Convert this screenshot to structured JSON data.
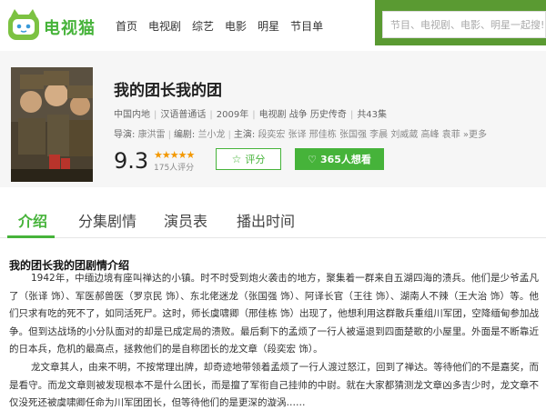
{
  "header": {
    "logo_text": "电视猫",
    "nav": [
      "首页",
      "电视剧",
      "综艺",
      "电影",
      "明星",
      "节目单"
    ],
    "search_placeholder": "节目、电视剧、电影、明星一起搜!"
  },
  "show": {
    "title": "我的团长我的团",
    "region": "中国内地",
    "language": "汉语普通话",
    "year": "2009年",
    "genres": "电视剧 战争 历史传奇",
    "episodes": "共43集",
    "director_label": "导演:",
    "director": "康洪雷",
    "writer_label": "编剧:",
    "writer": "兰小龙",
    "cast_label": "主演:",
    "cast": "段奕宏 张译 邢佳栋 张国强 李晨 刘威葳 高峰 袁菲",
    "more": "»更多",
    "score": "9.3",
    "stars": 4.5,
    "stars_text": "★★★★★",
    "rating_count": "175人评分",
    "rate_button": "评分",
    "want_button": "365人想看"
  },
  "tabs": [
    "介绍",
    "分集剧情",
    "演员表",
    "播出时间"
  ],
  "content": {
    "section_title": "我的团长我的团剧情介绍",
    "paragraphs": [
      "1942年，中缅边境有座叫禅达的小镇。时不时受到炮火袭击的地方，聚集着一群来自五湖四海的溃兵。他们是少爷孟凡了（张译 饰）、军医郝兽医（罗京民 饰）、东北佬迷龙（张国强 饰）、阿译长官（王往 饰）、湖南人不辣（王大治 饰）等。他们只求有吃的死不了，如同活死尸。这时，师长虞啸卿（邢佳栋 饰）出现了，他想利用这群散兵重组川军团，空降缅甸参加战争。但到达战场的小分队面对的却是已成定局的溃败。最后剩下的孟烦了一行人被逼退到四面楚歌的小屋里。外面是不断靠近的日本兵，危机的最高点，拯救他们的是自称团长的龙文章（段奕宏 饰）。",
      "龙文章其人，由来不明，不按常理出牌，却奇迹地带领着孟烦了一行人渡过怒江，回到了禅达。等待他们的不是嘉奖，而是看守。而龙文章则被发现根本不是什么团长，而是擅了军衔自己挂帅的中尉。就在大家都猜测龙文章凶多吉少时，龙文章不仅没死还被虞啸卿任命为川军团团长，但等待他们的是更深的漩涡……"
    ]
  }
}
